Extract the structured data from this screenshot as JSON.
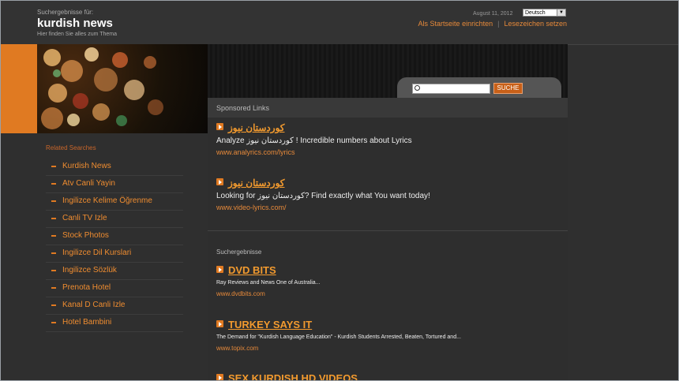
{
  "header": {
    "search_results_for": "Suchergebnisse für:",
    "title": "kurdish news",
    "subtitle": "Hier finden Sie alles zum Thema",
    "date": "August 11, 2012",
    "language": "Deutsch",
    "link_homepage": "Als Startseite einrichten",
    "link_bookmark": "Lesezeichen setzen"
  },
  "search": {
    "placeholder": "",
    "button_label": "SUCHE"
  },
  "sidebar": {
    "title": "Related Searches",
    "items": [
      "Kurdish News",
      "Atv Canli Yayin",
      "Ingilizce Kelime Öğrenme",
      "Canli TV Izle",
      "Stock Photos",
      "Ingilizce Dil Kurslari",
      "Ingilizce Sözlük",
      "Prenota Hotel",
      "Kanal D Canli Izle",
      "Hotel Bambini"
    ]
  },
  "sponsored": {
    "heading": "Sponsored Links",
    "ads": [
      {
        "title": "كوردستان نيوز",
        "desc": "Analyze كوردستان نيوز ! Incredible numbers about Lyrics",
        "url": "www.analyrics.com/lyrics"
      },
      {
        "title": "كوردستان نيوز",
        "desc": "Looking for كوردستان نيوز? Find exactly what You want today!",
        "url": "www.video-lyrics.com/"
      }
    ]
  },
  "results": {
    "heading": "Suchergebnisse",
    "items": [
      {
        "title": "DVD BITS",
        "desc": "Ray Reviews and News   One of Australia...",
        "url": "www.dvdbits.com"
      },
      {
        "title": "TURKEY SAYS IT",
        "desc": "The Demand for \"Kurdish Language Education\" - Kurdish Students Arrested, Beaten, Tortured and...",
        "url": "www.topix.com"
      },
      {
        "title": "SEX KURDISH HD VIDEOS",
        "desc": "",
        "url": ""
      }
    ]
  },
  "colors": {
    "accent": "#e07a22",
    "link": "#f29a2e",
    "background": "#2f2f2f"
  }
}
